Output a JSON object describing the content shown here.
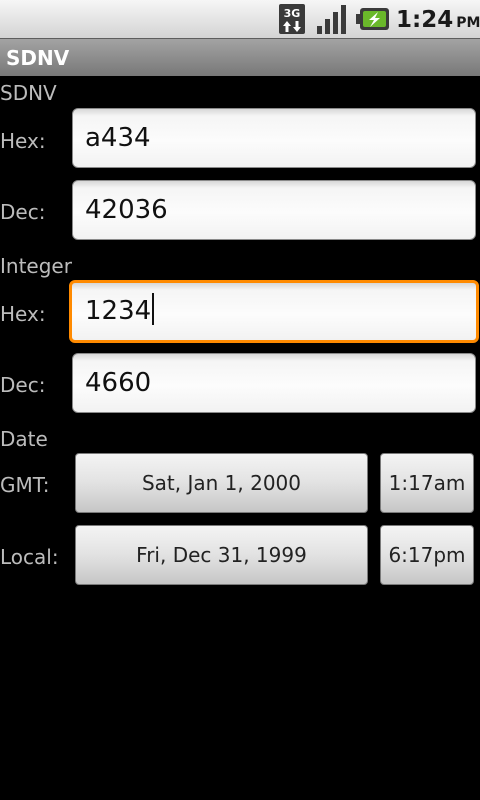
{
  "status_bar": {
    "time": "1:24",
    "ampm": "PM",
    "network_label": "3G",
    "icons": [
      "3g-data-icon",
      "signal-icon",
      "battery-charging-icon"
    ]
  },
  "app": {
    "title": "SDNV"
  },
  "sdnv": {
    "section_label": "SDNV",
    "hex_label": "Hex:",
    "hex_value": "a434",
    "dec_label": "Dec:",
    "dec_value": "42036"
  },
  "integer": {
    "section_label": "Integer",
    "hex_label": "Hex:",
    "hex_value": "1234",
    "dec_label": "Dec:",
    "dec_value": "4660"
  },
  "date": {
    "section_label": "Date",
    "gmt_label": "GMT:",
    "gmt_date": "Sat, Jan 1, 2000",
    "gmt_time": "1:17am",
    "local_label": "Local:",
    "local_date": "Fri, Dec 31, 1999",
    "local_time": "6:17pm"
  },
  "colors": {
    "focus": "#ff8a00",
    "battery": "#6ab82a",
    "background": "#000000"
  }
}
